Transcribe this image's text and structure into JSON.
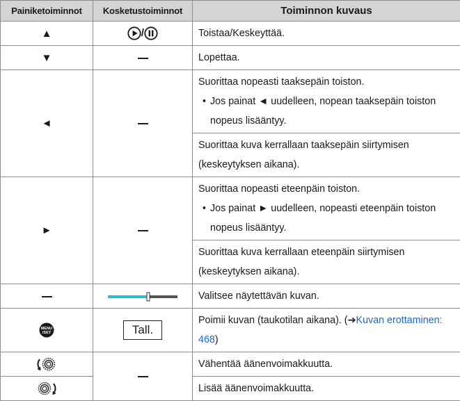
{
  "headers": {
    "col1": "Painiketoiminnot",
    "col2": "Kosketustoiminnot",
    "col3": "Toiminnon kuvaus"
  },
  "rows": {
    "play": {
      "button": "▲",
      "touch_sep": "/",
      "touch_icons": [
        "play-icon",
        "pause-icon"
      ],
      "desc": "Toistaa/Keskeyttää."
    },
    "stop": {
      "button": "▼",
      "desc": "Lopettaa."
    },
    "rewind": {
      "button": "◄",
      "desc1": "Suorittaa nopeasti taaksepäin toiston.",
      "bullet": "Jos painat ◄ uudelleen, nopean taaksepäin toiston nopeus lisääntyy.",
      "desc2": "Suorittaa kuva kerrallaan taaksepäin siirtymisen (keskeytyksen aikana)."
    },
    "forward": {
      "button": "►",
      "desc1": "Suorittaa nopeasti eteenpäin toiston.",
      "bullet": "Jos painat ► uudelleen, nopeasti eteenpäin toiston nopeus lisääntyy.",
      "desc2": "Suorittaa kuva kerrallaan eteenpäin siirtymisen (keskeytyksen aikana)."
    },
    "select": {
      "touch_icon": "slider-bar-icon",
      "slider_level": 0.58,
      "desc": "Valitsee näytettävän kuvan."
    },
    "save": {
      "button_icon": "menu-set-button-icon",
      "button_icon_text": [
        "MENU",
        "/SET"
      ],
      "touch_label": "Tall.",
      "desc": "Poimii kuvan (taukotilan aikana). (",
      "link_arrow": "➔",
      "link_text": "Kuvan erottaminen: 468",
      "desc_end": ")"
    },
    "vol_down": {
      "button_icon": "dial-left-icon",
      "desc": "Vähentää äänenvoimakkuutta."
    },
    "vol_up": {
      "button_icon": "dial-right-icon",
      "desc": "Lisää äänenvoimakkuutta."
    }
  },
  "colors": {
    "header_bg": "#d4d4d4",
    "border": "#8c8c8c",
    "link": "#1e69c8",
    "slider_fill": "#37b7c8",
    "slider_rest": "#555555"
  }
}
